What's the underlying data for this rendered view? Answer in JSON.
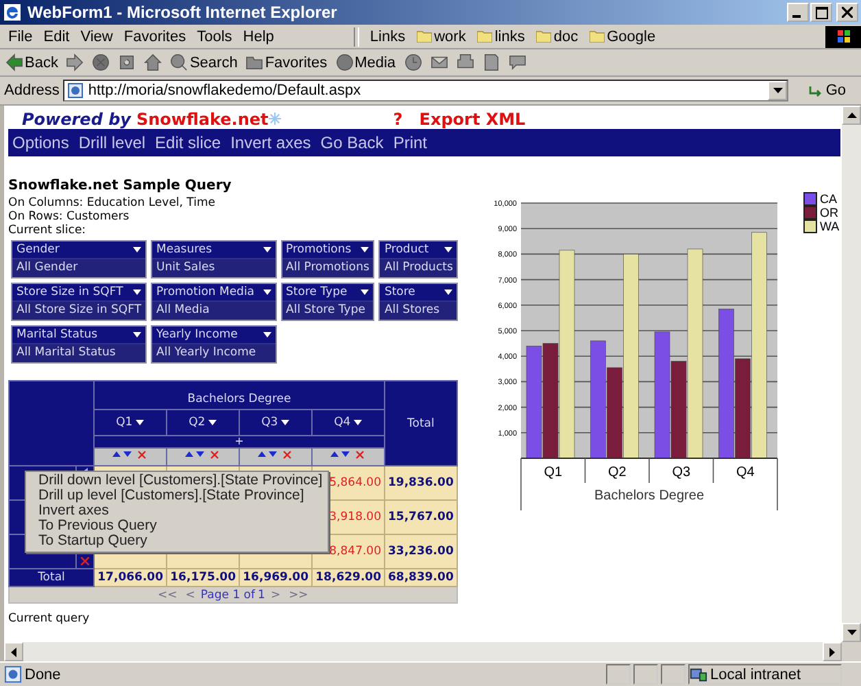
{
  "window": {
    "title": "WebForm1 - Microsoft Internet Explorer"
  },
  "menu_bar": [
    "File",
    "Edit",
    "View",
    "Favorites",
    "Tools",
    "Help"
  ],
  "links_bar": {
    "label": "Links",
    "items": [
      "work",
      "links",
      "doc",
      "Google"
    ]
  },
  "toolbar": [
    {
      "kind": "back",
      "label": "Back"
    },
    {
      "kind": "forward"
    },
    {
      "kind": "stop"
    },
    {
      "kind": "refresh"
    },
    {
      "kind": "home"
    },
    {
      "kind": "search",
      "label": "Search"
    },
    {
      "kind": "favorites",
      "label": "Favorites"
    },
    {
      "kind": "media",
      "label": "Media"
    },
    {
      "kind": "history"
    },
    {
      "kind": "mail"
    },
    {
      "kind": "print"
    },
    {
      "kind": "edit"
    },
    {
      "kind": "discuss"
    }
  ],
  "address": {
    "label": "Address",
    "url": "http://moria/snowflakedemo/Default.aspx",
    "go": "Go"
  },
  "page": {
    "powered_by": "Powered by",
    "brand": "Snowflake.net",
    "help": "?",
    "export": "Export XML",
    "nav": [
      "Options",
      "Drill level",
      "Edit slice",
      "Invert axes",
      "Go Back",
      "Print"
    ],
    "query_title": "Snowflake.net Sample Query",
    "info_lines": [
      "On Columns: Education Level, Time",
      "On Rows: Customers",
      "Current slice:"
    ],
    "slicers": [
      {
        "dimension": "Gender",
        "value": "All Gender"
      },
      {
        "dimension": "Measures",
        "value": "Unit Sales"
      },
      {
        "dimension": "Promotions",
        "value": "All Promotions"
      },
      {
        "dimension": "Product",
        "value": "All Products"
      },
      {
        "dimension": "Store Size in SQFT",
        "value": "All Store Size in SQFT"
      },
      {
        "dimension": "Promotion Media",
        "value": "All Media"
      },
      {
        "dimension": "Store Type",
        "value": "All Store Type"
      },
      {
        "dimension": "Store",
        "value": "All Stores"
      },
      {
        "dimension": "Marital Status",
        "value": "All Marital Status"
      },
      {
        "dimension": "Yearly Income",
        "value": "All Yearly Income"
      }
    ],
    "pivot": {
      "column_group": "Bachelors Degree",
      "columns": [
        "Q1",
        "Q2",
        "Q3",
        "Q4"
      ],
      "expand": "+",
      "total_header": "Total",
      "total_row_label": "Total",
      "rows": [
        {
          "visible_cells": [
            "5,864.00"
          ],
          "total": "19,836.00"
        },
        {
          "visible_cells": [
            "3,918.00"
          ],
          "total": "15,767.00"
        },
        {
          "visible_cells": [
            "8,847.00"
          ],
          "total": "33,236.00"
        }
      ],
      "column_totals": [
        "17,066.00",
        "16,175.00",
        "16,969.00",
        "18,629.00"
      ],
      "grand_total": "68,839.00",
      "pager": {
        "first": "<<",
        "prev": "<",
        "label": "Page 1 of",
        "page": "1",
        "next": ">",
        "last": ">>"
      }
    },
    "context_menu": [
      "Drill down level [Customers].[State Province]",
      "Drill up level [Customers].[State Province]",
      "Invert axes",
      "To Previous Query",
      "To Startup Query"
    ],
    "current_query": "Current query",
    "chart_data": {
      "type": "bar",
      "xlabel": "Bachelors Degree",
      "categories": [
        "Q1",
        "Q2",
        "Q3",
        "Q4"
      ],
      "series": [
        {
          "name": "CA",
          "color": "#7b4ee6",
          "values": [
            4400,
            4600,
            4950,
            5850
          ]
        },
        {
          "name": "OR",
          "color": "#7a1c3c",
          "values": [
            4500,
            3550,
            3800,
            3900
          ]
        },
        {
          "name": "WA",
          "color": "#e6e2a2",
          "values": [
            8150,
            8000,
            8200,
            8850
          ]
        }
      ],
      "grid": true,
      "ylim": [
        0,
        10000
      ],
      "yticks": [
        {
          "value": 1000,
          "label": "1,000"
        },
        {
          "value": 2000,
          "label": "2,000"
        },
        {
          "value": 3000,
          "label": "3,000"
        },
        {
          "value": 4000,
          "label": "4,000"
        },
        {
          "value": 5000,
          "label": "5,000"
        },
        {
          "value": 6000,
          "label": "6,000"
        },
        {
          "value": 7000,
          "label": "7,000"
        },
        {
          "value": 8000,
          "label": "8,000"
        },
        {
          "value": 9000,
          "label": "9,000"
        },
        {
          "value": 10000,
          "label": "10,000"
        }
      ]
    }
  },
  "status_bar": {
    "text": "Done",
    "zone": "Local intranet"
  }
}
